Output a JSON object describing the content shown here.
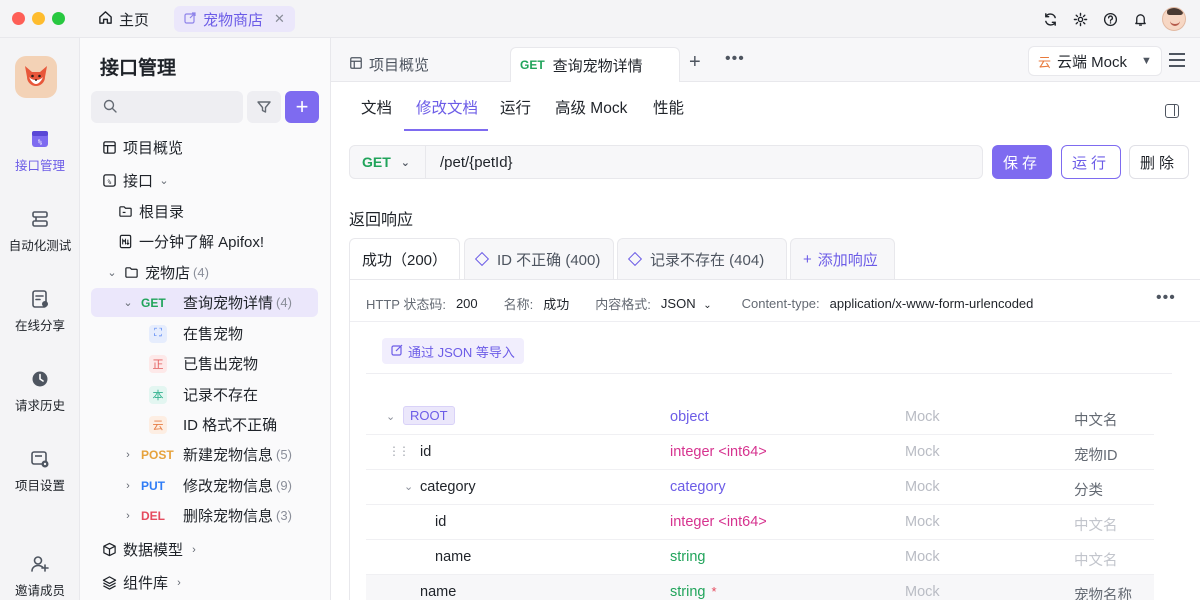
{
  "titlebar": {
    "home_label": "主页",
    "project_tab_label": "宠物商店"
  },
  "rail": [
    {
      "label": "接口管理",
      "icon": "api-icon",
      "active": true
    },
    {
      "label": "自动化测试",
      "icon": "automation-icon",
      "active": false
    },
    {
      "label": "在线分享",
      "icon": "share-icon",
      "active": false
    },
    {
      "label": "请求历史",
      "icon": "history-icon",
      "active": false
    },
    {
      "label": "项目设置",
      "icon": "settings-icon",
      "active": false
    },
    {
      "label": "邀请成员",
      "icon": "invite-icon",
      "active": false
    }
  ],
  "sidebar": {
    "title": "接口管理",
    "search_placeholder": "",
    "tree": {
      "overview": "项目概览",
      "apis": "接口",
      "root_dir": "根目录",
      "doc": "一分钟了解 Apifox!",
      "folder": {
        "label": "宠物店",
        "count": "(4)"
      },
      "selected": {
        "method": "GET",
        "label": "查询宠物详情",
        "count": "(4)"
      },
      "cases": [
        {
          "tag": "⛶",
          "label": "在售宠物"
        },
        {
          "tag": "正",
          "label": "已售出宠物"
        },
        {
          "tag": "本",
          "label": "记录不存在"
        },
        {
          "tag": "云",
          "label": "ID 格式不正确"
        }
      ],
      "others": [
        {
          "method": "POST",
          "label": "新建宠物信息",
          "count": "(5)"
        },
        {
          "method": "PUT",
          "label": "修改宠物信息",
          "count": "(9)"
        },
        {
          "method": "DEL",
          "label": "删除宠物信息",
          "count": "(3)"
        }
      ],
      "data_models": "数据模型",
      "components": "组件库"
    }
  },
  "main": {
    "doc_tabs": {
      "overview": "项目概览",
      "active_method": "GET",
      "active_label": "查询宠物详情"
    },
    "env": {
      "badge": "云",
      "label": "云端 Mock"
    },
    "subtabs": [
      "文档",
      "修改文档",
      "运行",
      "高级 Mock",
      "性能"
    ],
    "request": {
      "method": "GET",
      "path": "/pet/{petId}"
    },
    "buttons": {
      "save": "保存",
      "run": "运行",
      "delete": "删除"
    },
    "response_section": "返回响应",
    "response_tabs": [
      "成功（200）",
      "ID 不正确 (400)",
      "记录不存在 (404)",
      "添加响应"
    ],
    "meta": {
      "status_label": "HTTP 状态码:",
      "status_value": "200",
      "name_label": "名称:",
      "name_value": "成功",
      "format_label": "内容格式:",
      "format_value": "JSON",
      "ctype_label": "Content-type:",
      "ctype_value": "application/x-www-form-urlencoded"
    },
    "import_label": "通过 JSON 等导入",
    "schema": [
      {
        "name": "ROOT",
        "type": "object",
        "mock": "Mock",
        "cn": "中文名"
      },
      {
        "name": "id",
        "type": "integer <int64>",
        "mock": "Mock",
        "cn": "宠物ID"
      },
      {
        "name": "category",
        "type": "category",
        "mock": "Mock",
        "cn": "分类"
      },
      {
        "name": "id",
        "type": "integer <int64>",
        "mock": "Mock",
        "cn": "中文名"
      },
      {
        "name": "name",
        "type": "string",
        "mock": "Mock",
        "cn": "中文名"
      },
      {
        "name": "name",
        "type": "string",
        "required": "*",
        "mock": "Mock",
        "cn": "宠物名称"
      }
    ]
  }
}
